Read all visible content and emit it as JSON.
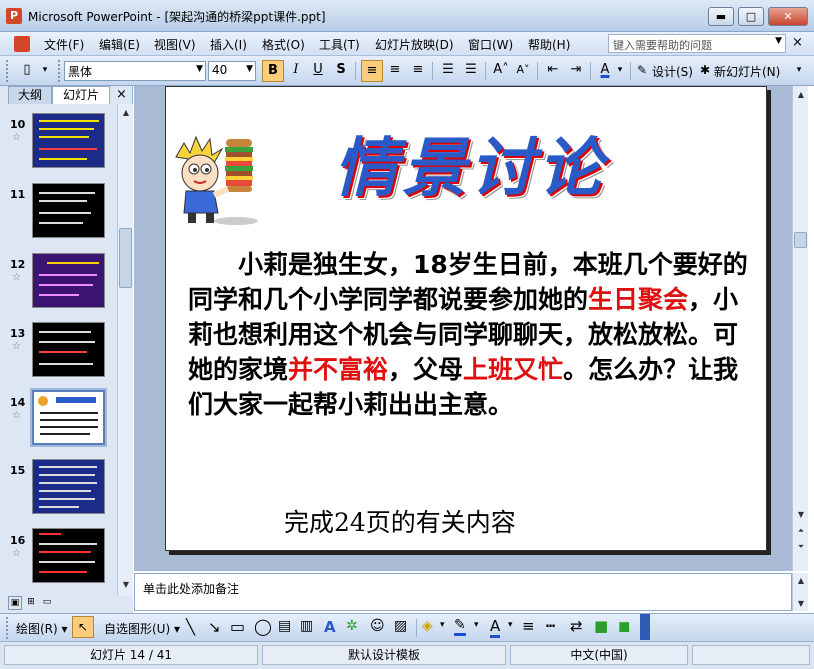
{
  "window": {
    "title": "Microsoft PowerPoint - [架起沟通的桥梁ppt课件.ppt]",
    "app_icon_letter": "P"
  },
  "menu": {
    "items": [
      "文件(F)",
      "编辑(E)",
      "视图(V)",
      "插入(I)",
      "格式(O)",
      "工具(T)",
      "幻灯片放映(D)",
      "窗口(W)",
      "帮助(H)"
    ],
    "help_placeholder": "键入需要帮助的问题"
  },
  "toolbar": {
    "font_name": "黑体",
    "font_size": "40",
    "design_label": "设计(S)",
    "new_slide_label": "新幻灯片(N)"
  },
  "left_pane": {
    "tabs": [
      "大纲",
      "幻灯片"
    ],
    "close_glyph": "×",
    "slides": [
      {
        "number": "10"
      },
      {
        "number": "11"
      },
      {
        "number": "12"
      },
      {
        "number": "13"
      },
      {
        "number": "14"
      },
      {
        "number": "15"
      },
      {
        "number": "16"
      }
    ],
    "selected_slide": "14"
  },
  "slide": {
    "title": "情景讨论",
    "body_segments": [
      {
        "text": "　　小莉是独生女，18岁生日前，本班几个要好的同学和几个小学同学都说要参加她的",
        "color": "#000000"
      },
      {
        "text": "生日聚会",
        "color": "#e01010"
      },
      {
        "text": "，小莉也想利用这个机会与同学聊聊天，放松放松。可她的家境",
        "color": "#000000"
      },
      {
        "text": "并不富裕",
        "color": "#e01010"
      },
      {
        "text": "，父母",
        "color": "#000000"
      },
      {
        "text": "上班又忙",
        "color": "#e01010"
      },
      {
        "text": "。怎么办？让我们大家一起帮小莉出出主意。",
        "color": "#000000"
      }
    ],
    "footer": "完成24页的有关内容"
  },
  "notes": {
    "placeholder": "单击此处添加备注"
  },
  "drawing_toolbar": {
    "draw_label": "绘图(R)",
    "autoshapes_label": "自选图形(U)"
  },
  "status": {
    "slide_info": "幻灯片 14 / 41",
    "template": "默认设计模板",
    "language": "中文(中国)"
  },
  "colors": {
    "accent_title_blue": "#2a5ac7",
    "highlight_red": "#e01010",
    "active_button": "#fbcc7c"
  }
}
